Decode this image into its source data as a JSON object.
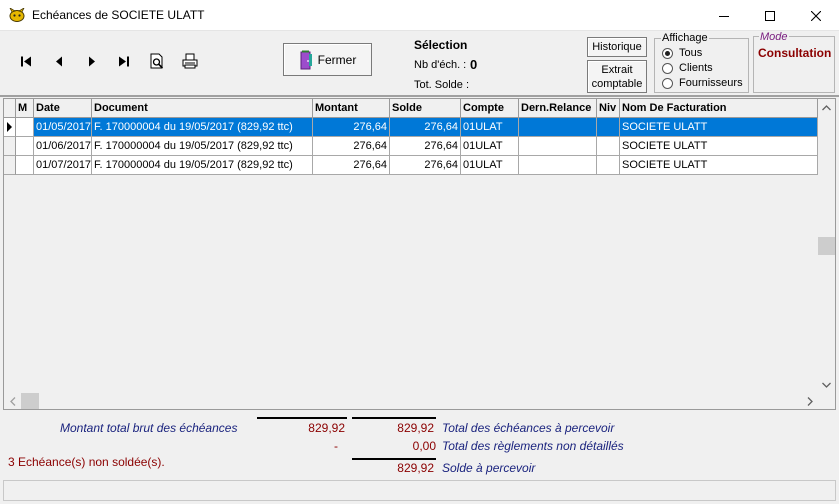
{
  "window": {
    "title": "Echéances de SOCIETE ULATT"
  },
  "toolbar": {
    "nav_icons": [
      "first-record-icon",
      "previous-record-icon",
      "next-record-icon",
      "last-record-icon",
      "preview-icon",
      "print-icon"
    ],
    "fermer_label": "Fermer",
    "selection_title": "Sélection",
    "nb_ech_label": "Nb d'éch. :",
    "nb_ech_value": "0",
    "tot_solde_label": "Tot. Solde :",
    "historique_label": "Historique",
    "extrait_label_1": "Extrait",
    "extrait_label_2": "comptable",
    "affichage": {
      "legend": "Affichage",
      "options": [
        "Tous",
        "Clients",
        "Fournisseurs"
      ],
      "selected": "Tous"
    },
    "mode": {
      "legend": "Mode",
      "value": "Consultation"
    }
  },
  "grid": {
    "columns": [
      "M",
      "Date",
      "Document",
      "Montant",
      "Solde",
      "Compte",
      "Dern.Relance",
      "Niv",
      "Nom De Facturation"
    ],
    "rows": [
      [
        "",
        "01/05/2017",
        "F. 170000004 du 19/05/2017 (829,92 ttc)",
        "276,64",
        "276,64",
        "01ULAT",
        "",
        "",
        "SOCIETE ULATT"
      ],
      [
        "",
        "01/06/2017",
        "F. 170000004 du 19/05/2017 (829,92 ttc)",
        "276,64",
        "276,64",
        "01ULAT",
        "",
        "",
        "SOCIETE ULATT"
      ],
      [
        "",
        "01/07/2017",
        "F. 170000004 du 19/05/2017 (829,92 ttc)",
        "276,64",
        "276,64",
        "01ULAT",
        "",
        "",
        "SOCIETE ULATT"
      ]
    ],
    "selected_row": 0
  },
  "totals": {
    "montant_brut_label": "Montant total brut des échéances",
    "montant_brut_value": "829,92",
    "total_echeances_value": "829,92",
    "total_echeances_label": "Total des échéances à percevoir",
    "reglements_left": "-",
    "reglements_value": "0,00",
    "reglements_label": "Total des règlements non détaillés",
    "count_label": "3 Echéance(s) non soldée(s).",
    "solde_value": "829,92",
    "solde_label": "Solde à percevoir"
  },
  "colors": {
    "selection": "#0078d7",
    "value_red": "#8b0000",
    "label_blue": "#1a237e",
    "mode_purple": "#7a1f80"
  }
}
